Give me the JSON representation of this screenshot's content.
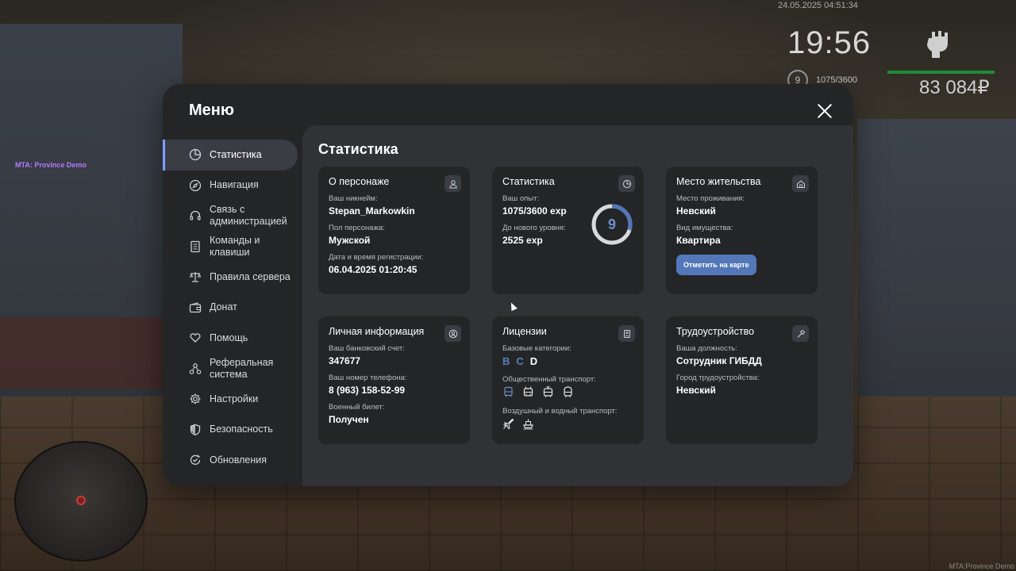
{
  "hud": {
    "datetime": "24.05.2025 04:51:34",
    "time": "19:56",
    "level": "9",
    "exp": "1075/3600",
    "money": "83 084₽",
    "server_label": "MTA: Province Demo",
    "watermark": "MTA:Province Demo"
  },
  "menu": {
    "title": "Меню",
    "nav": [
      {
        "label": "Статистика",
        "icon": "pie-chart-icon"
      },
      {
        "label": "Навигация",
        "icon": "compass-icon"
      },
      {
        "label": "Связь с администрацией",
        "icon": "headset-icon"
      },
      {
        "label": "Команды и клавиши",
        "icon": "document-icon"
      },
      {
        "label": "Правила сервера",
        "icon": "scales-icon"
      },
      {
        "label": "Донат",
        "icon": "wallet-icon"
      },
      {
        "label": "Помощь",
        "icon": "heart-hand-icon"
      },
      {
        "label": "Реферальная система",
        "icon": "network-icon"
      },
      {
        "label": "Настройки",
        "icon": "gear-icon"
      },
      {
        "label": "Безопасность",
        "icon": "shield-icon"
      },
      {
        "label": "Обновления",
        "icon": "refresh-check-icon"
      }
    ],
    "active_index": 0
  },
  "content": {
    "title": "Статистика",
    "character": {
      "title": "О персонаже",
      "nick_label": "Ваш никнейм:",
      "nick": "Stepan_Markowkin",
      "gender_label": "Пол персонажа:",
      "gender": "Мужской",
      "reg_label": "Дата и время регистрации:",
      "reg": "06.04.2025 01:20:45"
    },
    "stats": {
      "title": "Статистика",
      "exp_label": "Ваш опыт:",
      "exp": "1075/3600 exp",
      "next_label": "До нового уровня:",
      "next": "2525 exp",
      "level": "9",
      "progress": 0.2986
    },
    "residence": {
      "title": "Место жительства",
      "place_label": "Место проживания:",
      "place": "Невский",
      "type_label": "Вид имущества:",
      "type": "Квартира",
      "map_button": "Отметить на карте"
    },
    "personal": {
      "title": "Личная информация",
      "bank_label": "Ваш банковский счет:",
      "bank": "347677",
      "phone_label": "Ваш номер телефона:",
      "phone": "8 (963) 158-52-99",
      "military_label": "Военный билет:",
      "military": "Получен"
    },
    "licenses": {
      "title": "Лицензии",
      "base_label": "Базовые категории:",
      "categories": [
        {
          "letter": "B",
          "active": true
        },
        {
          "letter": "C",
          "active": true
        },
        {
          "letter": "D",
          "active": false
        }
      ],
      "public_label": "Общественный транспорт:",
      "public_icons": [
        "bus-icon",
        "trolleybus-icon",
        "tram-icon",
        "subway-icon"
      ],
      "air_label": "Воздушный и водный транспорт:",
      "air_icons": [
        "plane-icon",
        "boat-icon"
      ]
    },
    "job": {
      "title": "Трудоустройство",
      "position_label": "Ваша должность:",
      "position": "Сотрудник ГИБДД",
      "city_label": "Город трудоустройства:",
      "city": "Невский"
    }
  },
  "colors": {
    "accent": "#5377b9",
    "active_nav_indicator": "#7ea0ff",
    "panel_bg": "#242527",
    "content_bg": "#303236"
  }
}
